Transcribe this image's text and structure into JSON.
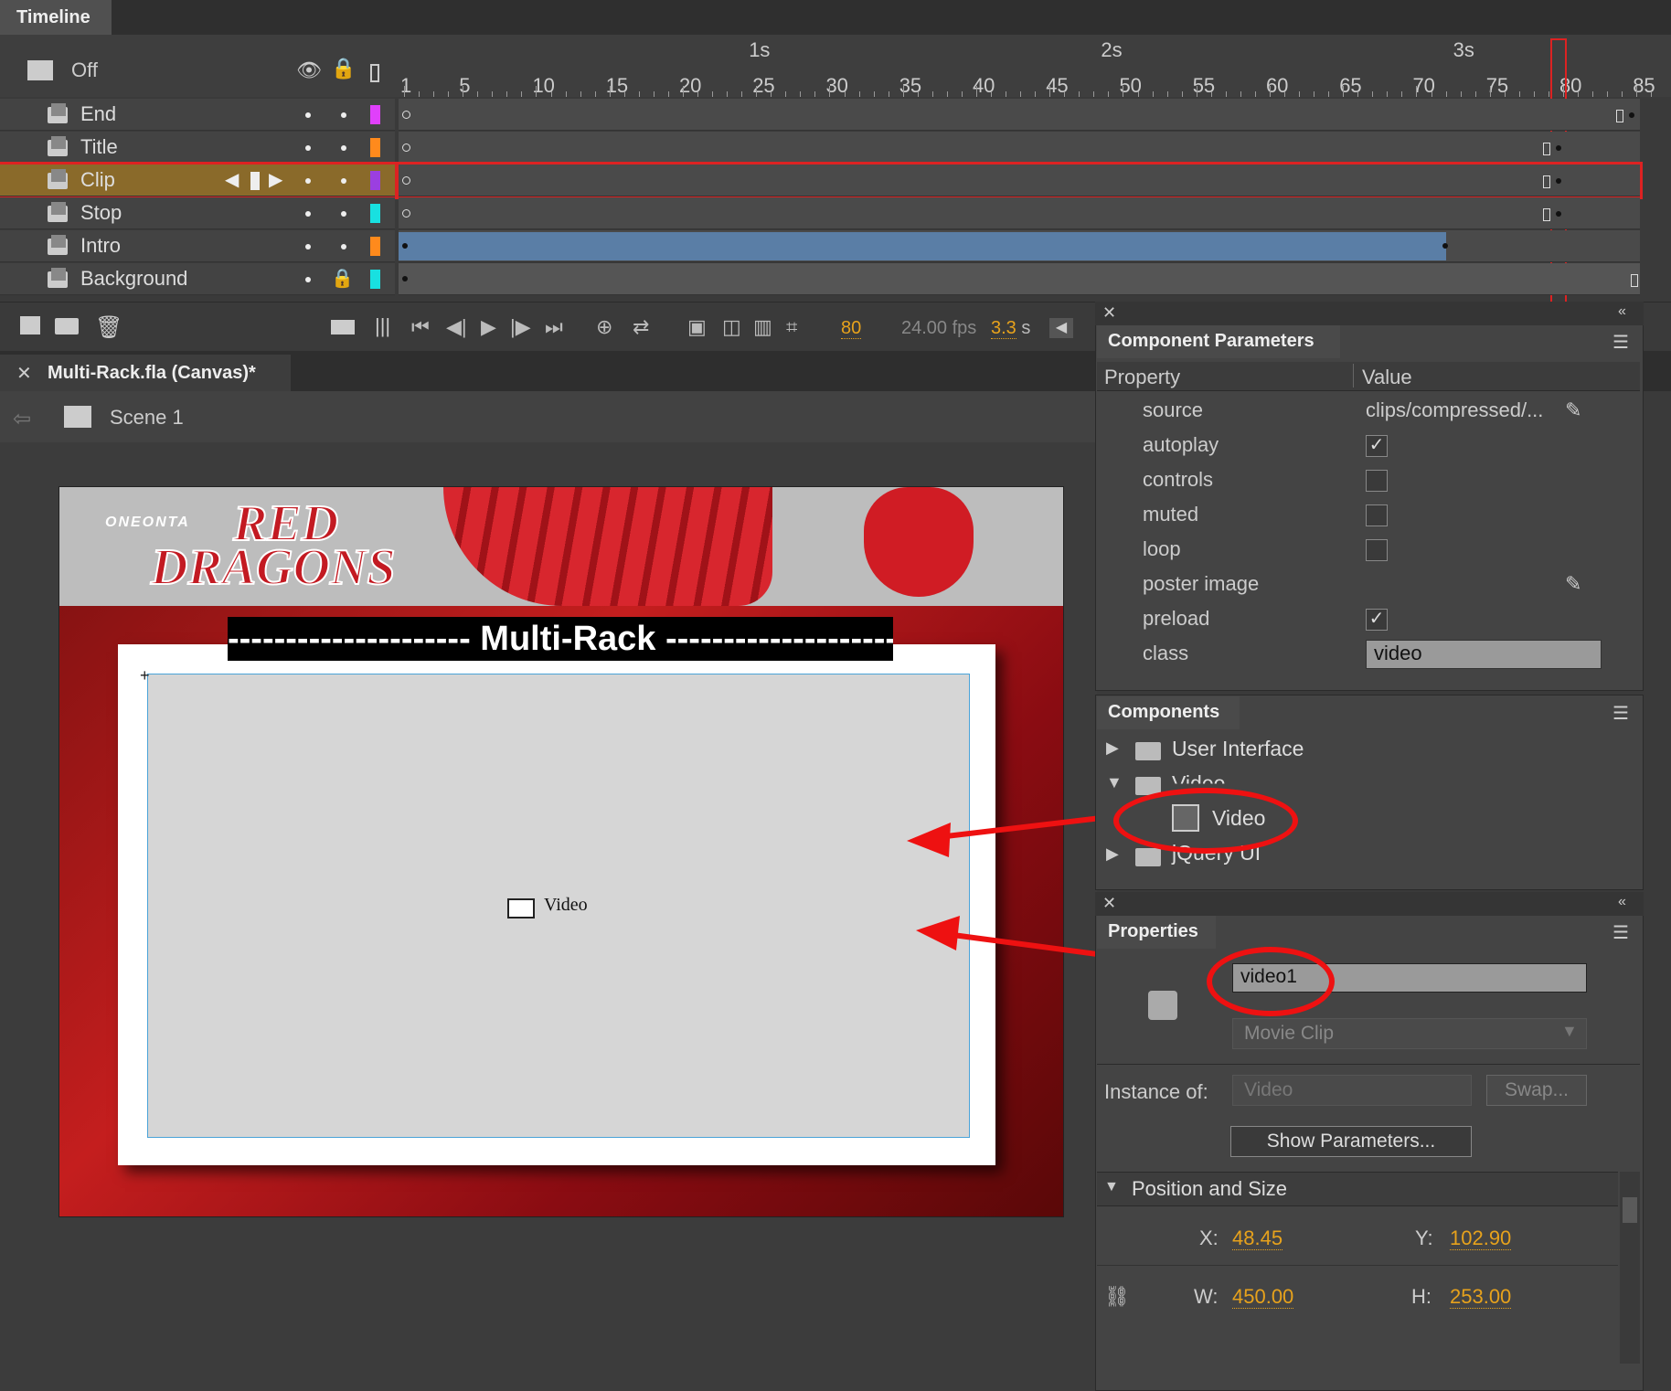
{
  "timeline": {
    "tab": "Timeline",
    "onion": "Off",
    "ticks_sec": [
      "1s",
      "2s",
      "3s"
    ],
    "ticks": [
      "1",
      "5",
      "10",
      "15",
      "20",
      "25",
      "30",
      "35",
      "40",
      "45",
      "50",
      "55",
      "60",
      "65",
      "70",
      "75",
      "80",
      "85"
    ],
    "layers": [
      {
        "name": "End",
        "color": "#e040fb"
      },
      {
        "name": "Title",
        "color": "#ff8a1c"
      },
      {
        "name": "Clip",
        "color": "#9b3fe0",
        "selected": true
      },
      {
        "name": "Stop",
        "color": "#18e0e0"
      },
      {
        "name": "Intro",
        "color": "#ff8a1c"
      },
      {
        "name": "Background",
        "color": "#18e0e0",
        "locked": true
      }
    ],
    "current_frame": "80",
    "fps": "24.00 fps",
    "time": "3.3",
    "time_unit": "s"
  },
  "doc": {
    "tab": "Multi-Rack.fla (Canvas)*",
    "scene": "Scene 1"
  },
  "stage": {
    "brand_small": "ONEONTA",
    "brand_big1": "RED",
    "brand_big2": "DRAGONS",
    "banner": "--------------------- Multi-Rack ---------------------",
    "video_label": "Video"
  },
  "component_params": {
    "title": "Component Parameters",
    "col_property": "Property",
    "col_value": "Value",
    "rows": [
      {
        "name": "source",
        "value": "clips/compressed/...",
        "type": "text"
      },
      {
        "name": "autoplay",
        "checked": true,
        "type": "check"
      },
      {
        "name": "controls",
        "checked": false,
        "type": "check"
      },
      {
        "name": "muted",
        "checked": false,
        "type": "check"
      },
      {
        "name": "loop",
        "checked": false,
        "type": "check"
      },
      {
        "name": "poster image",
        "type": "pencil"
      },
      {
        "name": "preload",
        "checked": true,
        "type": "check"
      },
      {
        "name": "class",
        "value": "video",
        "type": "input"
      }
    ]
  },
  "components": {
    "title": "Components",
    "items": [
      "User Interface",
      "Video",
      "Video",
      "jQuery UI"
    ]
  },
  "properties": {
    "title": "Properties",
    "instance_name": "video1",
    "type": "Movie Clip",
    "instance_of_label": "Instance of:",
    "instance_of": "Video",
    "swap": "Swap...",
    "show_params": "Show Parameters...",
    "pos_size_title": "Position and Size",
    "x_label": "X:",
    "x": "48.45",
    "y_label": "Y:",
    "y": "102.90",
    "w_label": "W:",
    "w": "450.00",
    "h_label": "H:",
    "h": "253.00"
  }
}
